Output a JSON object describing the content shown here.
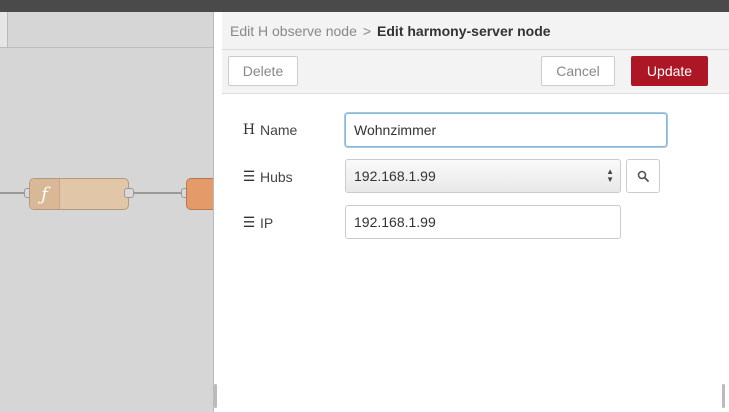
{
  "workspace": {
    "function_node_icon": "function-icon",
    "function_node_glyph": "ƒ"
  },
  "tray": {
    "breadcrumb": {
      "parent": "Edit H observe node",
      "separator": ">",
      "current": "Edit harmony-server node"
    },
    "toolbar": {
      "delete_label": "Delete",
      "cancel_label": "Cancel",
      "update_label": "Update"
    },
    "form": {
      "name": {
        "icon": "tag-h-icon",
        "icon_glyph": "H",
        "label": "Name",
        "value": "Wohnzimmer"
      },
      "hubs": {
        "icon": "list-icon",
        "icon_glyph": "☰",
        "label": "Hubs",
        "selected": "192.168.1.99",
        "search_icon": "search-icon"
      },
      "ip": {
        "icon": "list-icon",
        "icon_glyph": "☰",
        "label": "IP",
        "value": "192.168.1.99"
      }
    }
  },
  "colors": {
    "primary": "#ad1625",
    "function_node": "#e2c6a8",
    "orange_node": "#e59a6a",
    "focus_border": "#85b7d9"
  }
}
